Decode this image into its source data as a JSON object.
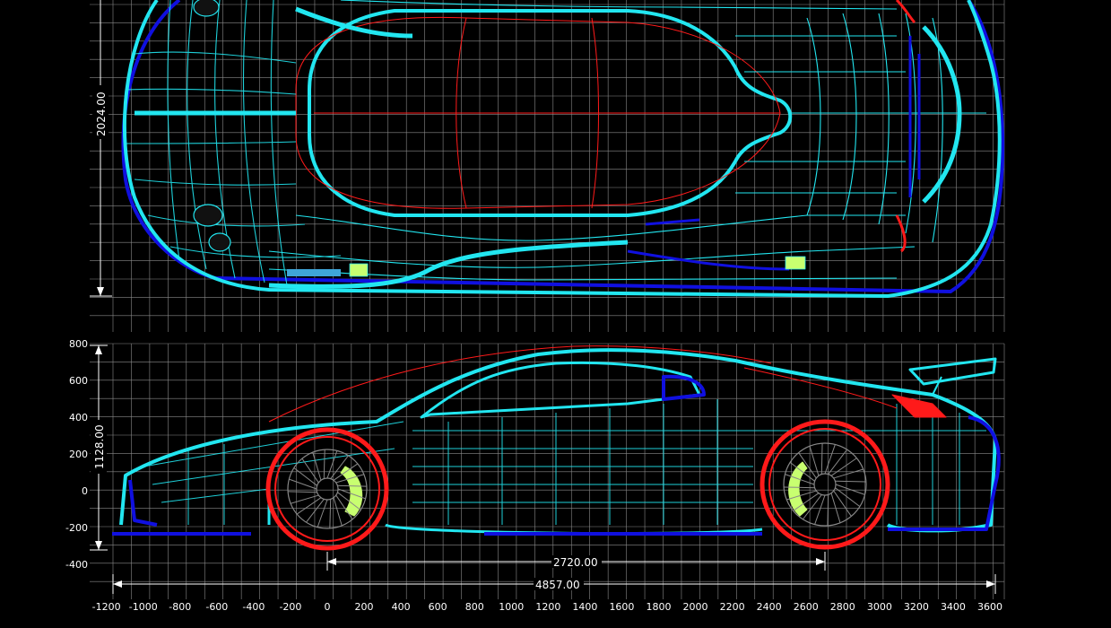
{
  "drawing": {
    "top_view": {
      "dimensions": {
        "width": "2024.00"
      }
    },
    "side_view": {
      "dimensions": {
        "height": "1128.00",
        "wheelbase": "2720.00",
        "overall_length": "4857.00"
      }
    },
    "x_axis_ticks": [
      "-1200",
      "-1000",
      "-800",
      "-600",
      "-400",
      "-200",
      "0",
      "200",
      "400",
      "600",
      "800",
      "1000",
      "1200",
      "1400",
      "1600",
      "1800",
      "2000",
      "2200",
      "2400",
      "2600",
      "2800",
      "3000",
      "3200",
      "3400",
      "3600"
    ],
    "y_axis_ticks": [
      "800",
      "600",
      "400",
      "200",
      "0",
      "-200",
      "-400"
    ]
  },
  "colors": {
    "background": "#000000",
    "grid": "#8a8a8a",
    "wireframe": "#22e6f0",
    "accent_blue": "#1010e0",
    "accent_red": "#ff1a1a",
    "accent_green": "#c8ff70",
    "dimension": "#ffffff"
  }
}
